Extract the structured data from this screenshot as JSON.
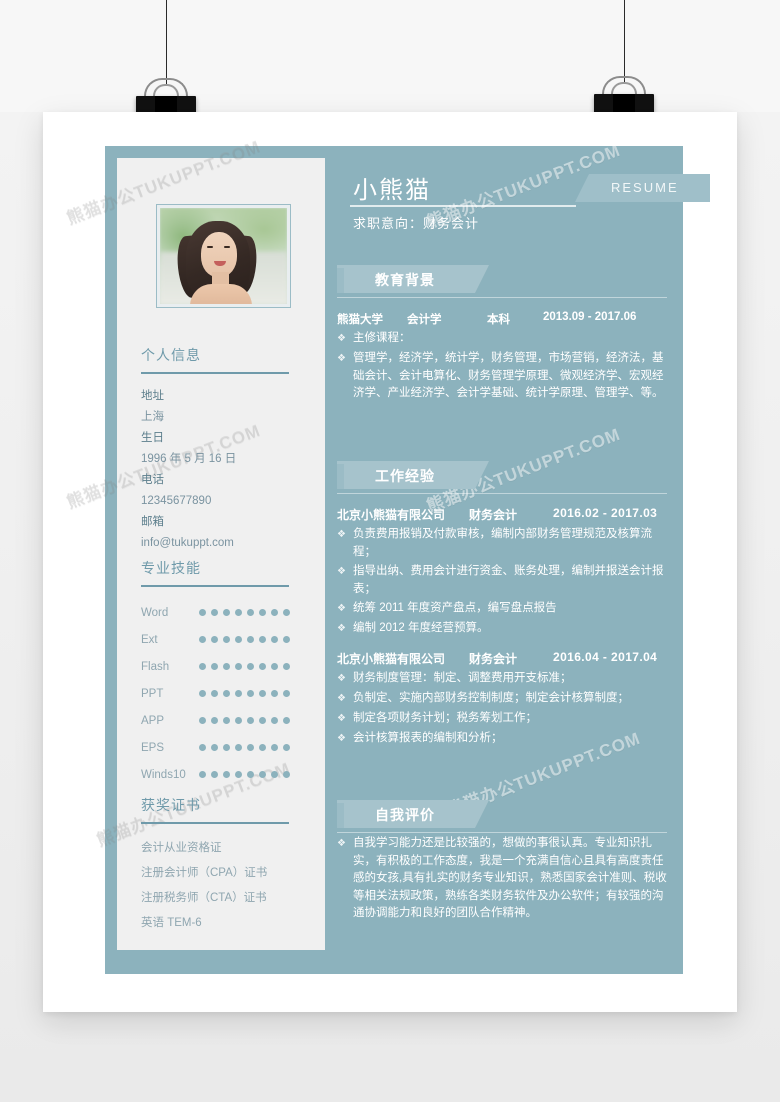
{
  "colors": {
    "teal": "#8cb2bd",
    "banner": "#a6c3cc",
    "sidebar_bg": "#f0f0f0",
    "accent_text": "#6f9aaa",
    "paper": "#ffffff"
  },
  "watermark": {
    "text": "熊猫办公TUKUPPT.COM"
  },
  "header": {
    "name": "小熊猫",
    "objective": "求职意向：财务会计",
    "badge": "RESUME"
  },
  "sidebar": {
    "personal": {
      "title": "个人信息",
      "fields": [
        {
          "label": "地址",
          "value": "上海"
        },
        {
          "label": "生日",
          "value": "1996 年 5 月 16 日"
        },
        {
          "label": "电话",
          "value": "12345677890"
        },
        {
          "label": "邮箱",
          "value": "info@tukuppt.com"
        }
      ]
    },
    "skills": {
      "title": "专业技能",
      "dot_count": 8,
      "items": [
        {
          "name": "Word",
          "level": 8
        },
        {
          "name": "Ext",
          "level": 8
        },
        {
          "name": "Flash",
          "level": 8
        },
        {
          "name": "PPT",
          "level": 8
        },
        {
          "name": "APP",
          "level": 8
        },
        {
          "name": "EPS",
          "level": 8
        },
        {
          "name": "Winds10",
          "level": 8
        }
      ]
    },
    "certificates": {
      "title": "获奖证书",
      "items": [
        "会计从业资格证",
        "注册会计师（CPA）证书",
        "注册税务师（CTA）证书",
        "英语 TEM-6"
      ]
    }
  },
  "main": {
    "education": {
      "title": "教育背景",
      "entry": {
        "school": "熊猫大学",
        "major": "会计学",
        "degree": "本科",
        "date": "2013.09 - 2017.06"
      },
      "bullets": [
        "主修课程：",
        "管理学，经济学，统计学，财务管理，市场营销，经济法，基础会计、会计电算化、财务管理学原理、微观经济学、宏观经济学、产业经济学、会计学基础、统计学原理、管理学、等。"
      ]
    },
    "work": {
      "title": "工作经验",
      "entries": [
        {
          "company": "北京小熊猫有限公司",
          "role": "财务会计",
          "date": "2016.02 - 2017.03",
          "bullets": [
            "负责费用报销及付款审核，编制内部财务管理规范及核算流程；",
            "指导出纳、费用会计进行资金、账务处理，编制并报送会计报表；",
            "统筹 2011 年度资产盘点，编写盘点报告",
            "编制 2012 年度经营预算。"
          ]
        },
        {
          "company": "北京小熊猫有限公司",
          "role": "财务会计",
          "date": "2016.04 - 2017.04",
          "bullets": [
            "财务制度管理：制定、调整费用开支标准；",
            "负制定、实施内部财务控制制度；制定会计核算制度；",
            "制定各项财务计划；税务筹划工作；",
            "会计核算报表的编制和分析；"
          ]
        }
      ]
    },
    "evaluation": {
      "title": "自我评价",
      "bullets": [
        "自我学习能力还是比较强的，想做的事很认真。专业知识扎实，有积极的工作态度，我是一个充满自信心且具有高度责任感的女孩,具有扎实的财务专业知识，熟悉国家会计准则、税收等相关法规政策，熟练各类财务软件及办公软件；有较强的沟通协调能力和良好的团队合作精神。"
      ]
    },
    "bullet_marker": "❖"
  }
}
